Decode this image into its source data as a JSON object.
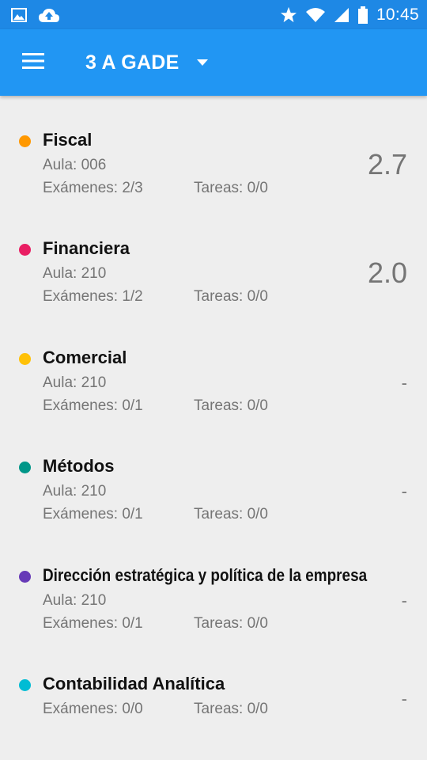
{
  "status_bar": {
    "left_icons": [
      "image-notification-icon",
      "cloud-upload-icon"
    ],
    "right_icons": [
      "star-icon",
      "wifi-icon",
      "signal-icon",
      "battery-icon"
    ],
    "time": "10:45"
  },
  "app_bar": {
    "menu_icon": "hamburger-menu-icon",
    "title": "3 A GADE",
    "dropdown_icon": "arrow-drop-down-icon",
    "color": "#2196f3",
    "status_color": "#1e88e5"
  },
  "subjects": [
    {
      "name": "Fiscal",
      "color": "#ff9800",
      "aula": "Aula: 006",
      "examenes": "Exámenes: 2/3",
      "tareas": "Tareas: 0/0",
      "grade": "2.7"
    },
    {
      "name": "Financiera",
      "color": "#e91e63",
      "aula": "Aula: 210",
      "examenes": "Exámenes: 1/2",
      "tareas": "Tareas: 0/0",
      "grade": "2.0"
    },
    {
      "name": "Comercial",
      "color": "#ffc107",
      "aula": "Aula: 210",
      "examenes": "Exámenes: 0/1",
      "tareas": "Tareas: 0/0",
      "grade": "-"
    },
    {
      "name": "Métodos",
      "color": "#009688",
      "aula": "Aula: 210",
      "examenes": "Exámenes: 0/1",
      "tareas": "Tareas: 0/0",
      "grade": "-"
    },
    {
      "name": "Dirección estratégica y política de la empresa",
      "color": "#673ab7",
      "aula": "Aula: 210",
      "examenes": "Exámenes: 0/1",
      "tareas": "Tareas: 0/0",
      "grade": "-"
    },
    {
      "name": "Contabilidad Analítica",
      "color": "#00bcd4",
      "aula": "",
      "examenes": "Exámenes: 0/0",
      "tareas": "Tareas: 0/0",
      "grade": "-"
    }
  ]
}
